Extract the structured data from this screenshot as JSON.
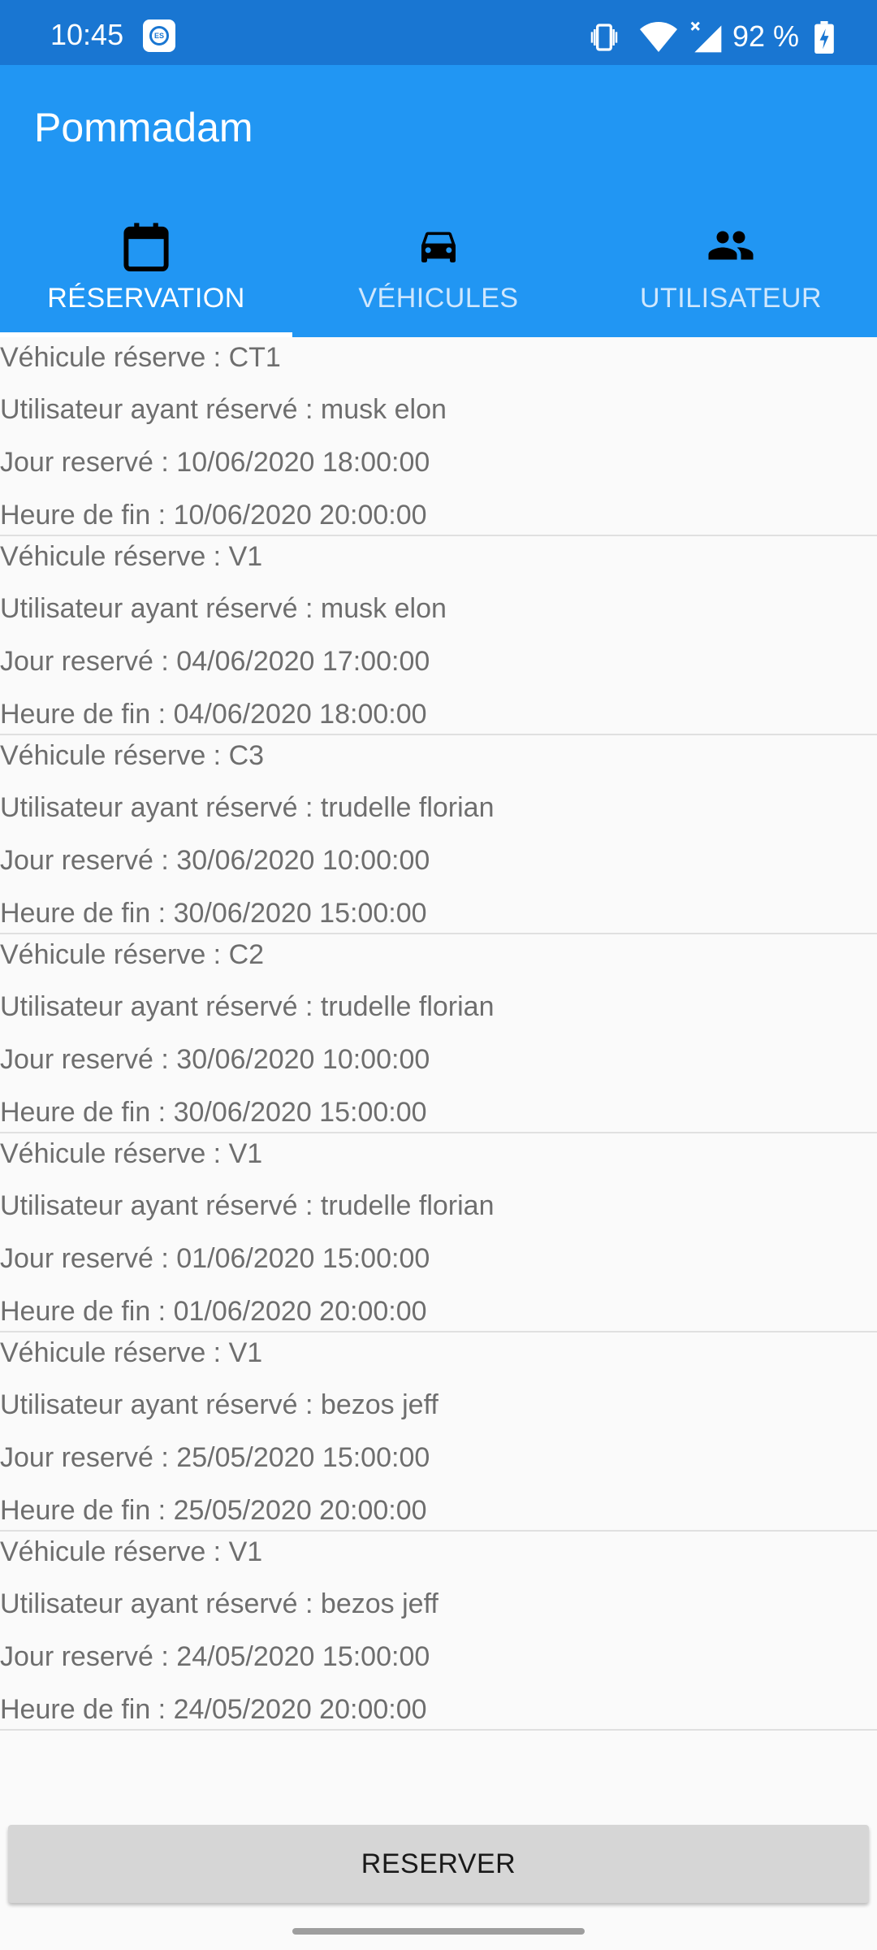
{
  "status_bar": {
    "time": "10:45",
    "battery": "92 %",
    "icons": [
      "app-notification-icon",
      "vibrate-icon",
      "wifi-icon",
      "signal-icon",
      "battery-charging-icon"
    ]
  },
  "app_bar": {
    "title": "Pommadam",
    "color": "#2196f3",
    "status_color": "#1976d2"
  },
  "tabs": [
    {
      "label": "RÉSERVATION",
      "icon": "calendar-icon",
      "active": true
    },
    {
      "label": "VÉHICULES",
      "icon": "car-icon",
      "active": false
    },
    {
      "label": "UTILISATEUR",
      "icon": "people-icon",
      "active": false
    }
  ],
  "reservations": [
    {
      "vehicle": "Véhicule réserve : CT1",
      "user": "Utilisateur ayant réservé : musk elon",
      "start": "Jour reservé : 10/06/2020 18:00:00",
      "end": "Heure de fin : 10/06/2020 20:00:00"
    },
    {
      "vehicle": "Véhicule réserve : V1",
      "user": "Utilisateur ayant réservé : musk elon",
      "start": "Jour reservé : 04/06/2020 17:00:00",
      "end": "Heure de fin : 04/06/2020 18:00:00"
    },
    {
      "vehicle": "Véhicule réserve : C3",
      "user": "Utilisateur ayant réservé : trudelle florian",
      "start": "Jour reservé : 30/06/2020 10:00:00",
      "end": "Heure de fin : 30/06/2020 15:00:00"
    },
    {
      "vehicle": "Véhicule réserve : C2",
      "user": "Utilisateur ayant réservé : trudelle florian",
      "start": "Jour reservé : 30/06/2020 10:00:00",
      "end": "Heure de fin : 30/06/2020 15:00:00"
    },
    {
      "vehicle": "Véhicule réserve : V1",
      "user": "Utilisateur ayant réservé : trudelle florian",
      "start": "Jour reservé : 01/06/2020 15:00:00",
      "end": "Heure de fin : 01/06/2020 20:00:00"
    },
    {
      "vehicle": "Véhicule réserve : V1",
      "user": "Utilisateur ayant réservé : bezos jeff",
      "start": "Jour reservé : 25/05/2020 15:00:00",
      "end": "Heure de fin : 25/05/2020 20:00:00"
    },
    {
      "vehicle": "Véhicule réserve : V1",
      "user": "Utilisateur ayant réservé : bezos jeff",
      "start": "Jour reservé : 24/05/2020 15:00:00",
      "end": "Heure de fin : 24/05/2020 20:00:00"
    }
  ],
  "actions": {
    "reserve_label": "RESERVER"
  }
}
